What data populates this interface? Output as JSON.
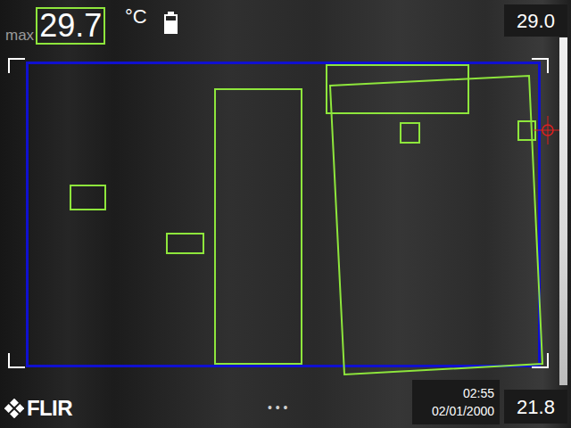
{
  "header": {
    "max_label": "max",
    "max_value": "29.7",
    "unit": "°C",
    "battery": {
      "level": 0.7
    }
  },
  "scale": {
    "top": "29.0",
    "bottom": "21.8"
  },
  "clock": {
    "time": "02:55",
    "date": "02/01/2000"
  },
  "logo": "FLIR",
  "menu": "• • •"
}
